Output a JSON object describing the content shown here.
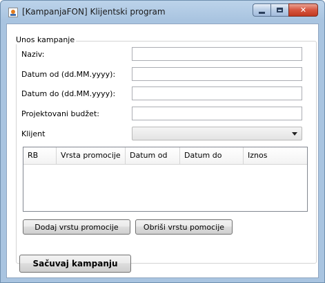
{
  "window": {
    "title": "[KampanjaFON] Klijentski program",
    "icon": "java-app-icon",
    "controls": [
      "minimize-icon",
      "maximize-icon",
      "close-icon"
    ],
    "close_glyph": "✕"
  },
  "form": {
    "group_title": "Unos kampanje",
    "fields": {
      "naziv": {
        "label": "Naziv:",
        "value": ""
      },
      "datum_od": {
        "label": "Datum od (dd.MM.yyyy):",
        "value": ""
      },
      "datum_do": {
        "label": "Datum do (dd.MM.yyyy):",
        "value": ""
      },
      "budzet": {
        "label": "Projektovani budžet:",
        "value": ""
      },
      "klijent": {
        "label": "Klijent",
        "selected": ""
      }
    },
    "table": {
      "columns": [
        "RB",
        "Vrsta promocije",
        "Datum od",
        "Datum do",
        "Iznos"
      ],
      "rows": []
    },
    "buttons": {
      "add_label": "Dodaj vrstu promocije",
      "delete_label": "Obriši vrstu pomocije"
    }
  },
  "save_label": "Sačuvaj kampanju"
}
